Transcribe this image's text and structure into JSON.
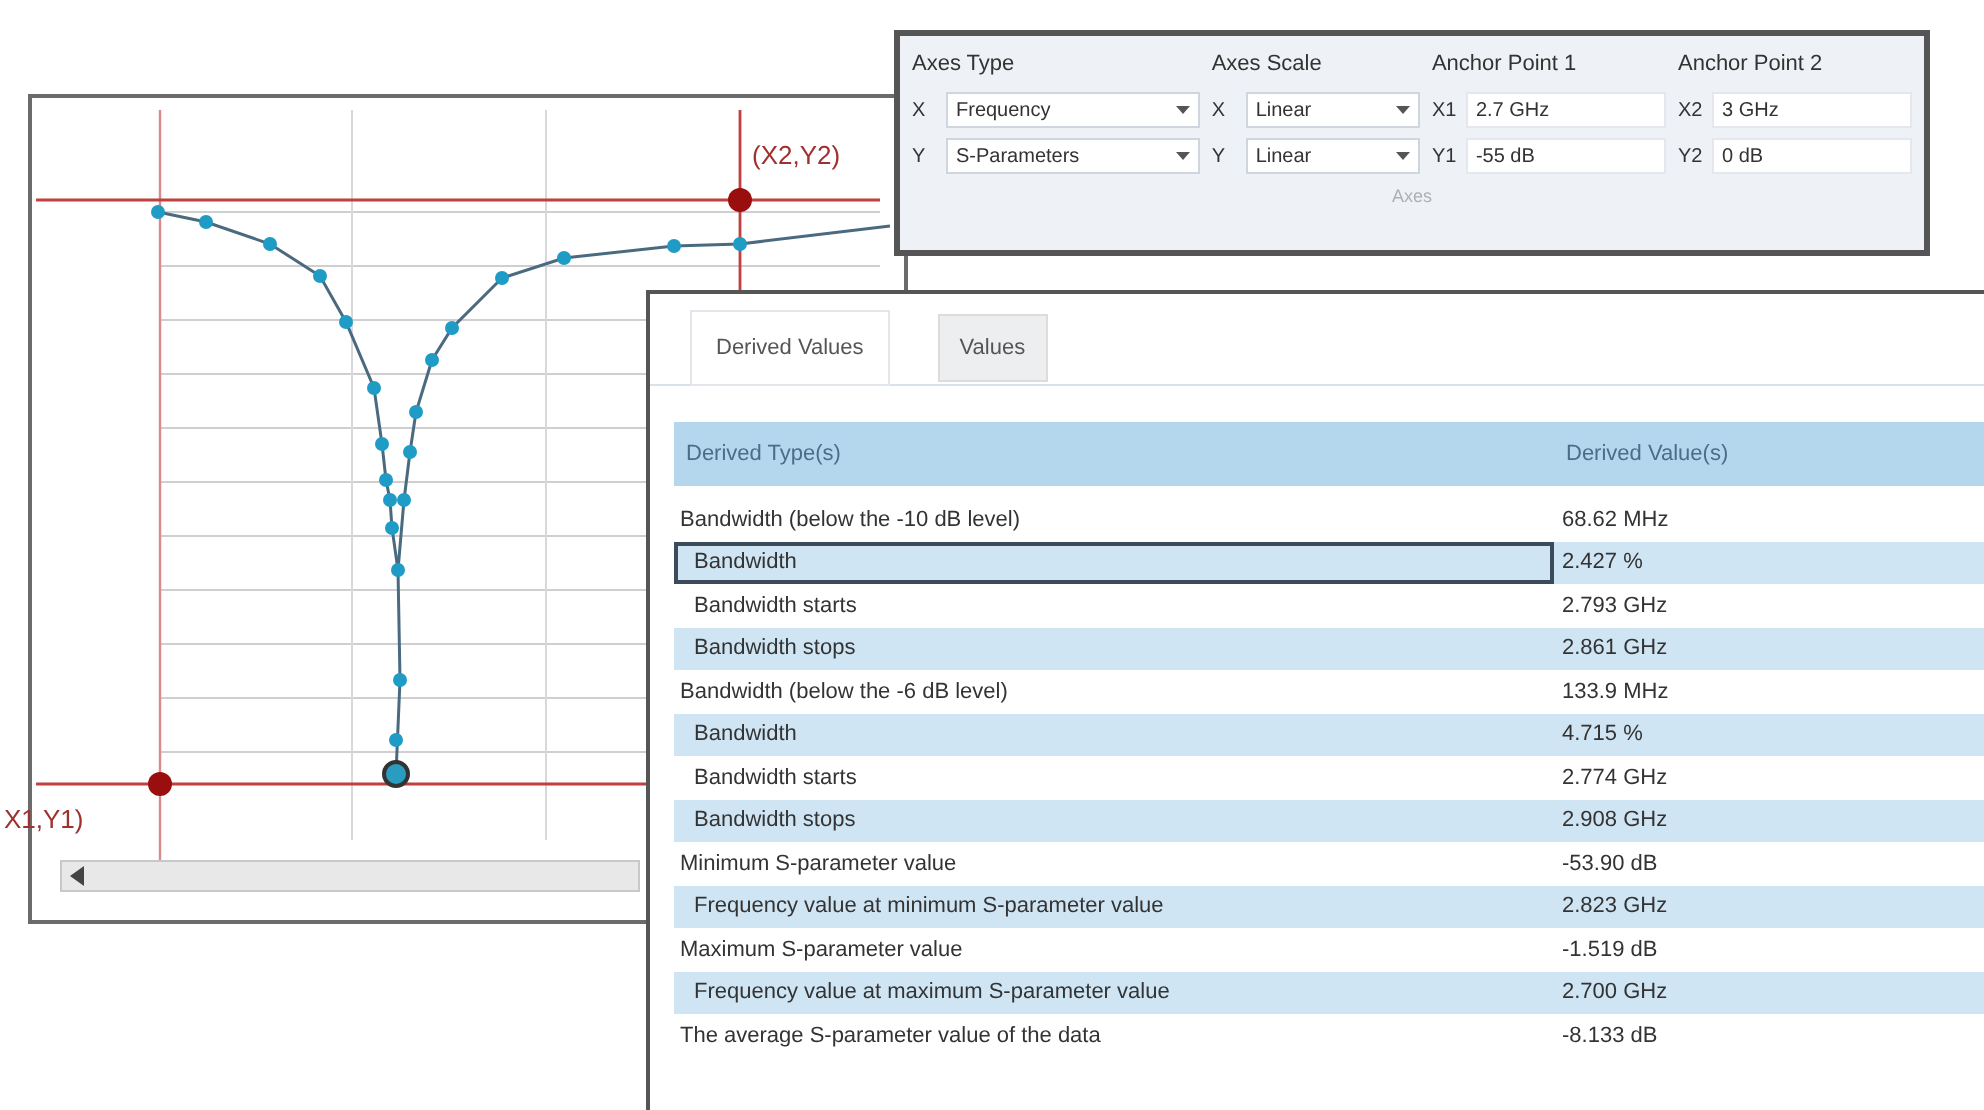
{
  "chart": {
    "anchor_labels": [
      "(X2,Y2)",
      "X1,Y1)"
    ]
  },
  "axes_panel": {
    "groups": [
      {
        "title": "Axes Type",
        "fields": [
          {
            "label": "X",
            "value": "Frequency",
            "kind": "dropdown"
          },
          {
            "label": "Y",
            "value": "S-Parameters",
            "kind": "dropdown"
          }
        ]
      },
      {
        "title": "Axes Scale",
        "fields": [
          {
            "label": "X",
            "value": "Linear",
            "kind": "dropdown"
          },
          {
            "label": "Y",
            "value": "Linear",
            "kind": "dropdown"
          }
        ]
      },
      {
        "title": "Anchor Point 1",
        "fields": [
          {
            "label": "X1",
            "value": "2.7 GHz",
            "kind": "text"
          },
          {
            "label": "Y1",
            "value": "-55 dB",
            "kind": "text"
          }
        ]
      },
      {
        "title": "Anchor Point 2",
        "fields": [
          {
            "label": "X2",
            "value": "3 GHz",
            "kind": "text"
          },
          {
            "label": "Y2",
            "value": "0 dB",
            "kind": "text"
          }
        ]
      }
    ],
    "caption": "Axes"
  },
  "results": {
    "tabs": [
      {
        "label": "Derived Values",
        "selected": true
      },
      {
        "label": "Values",
        "selected": false
      }
    ],
    "columns": [
      "Derived Type(s)",
      "Derived Value(s)"
    ],
    "rows": [
      {
        "type": "Bandwidth (below the -10 dB level)",
        "value": "68.62 MHz",
        "selected": false,
        "children": [
          {
            "type": "Bandwidth",
            "value": "2.427 %",
            "selected": true
          },
          {
            "type": "Bandwidth starts",
            "value": "2.793 GHz",
            "selected": false
          },
          {
            "type": "Bandwidth stops",
            "value": "2.861 GHz",
            "selected": false
          }
        ]
      },
      {
        "type": "Bandwidth (below the -6 dB level)",
        "value": "133.9 MHz",
        "selected": false,
        "children": [
          {
            "type": "Bandwidth",
            "value": "4.715 %",
            "selected": false
          },
          {
            "type": "Bandwidth starts",
            "value": "2.774 GHz",
            "selected": false
          },
          {
            "type": "Bandwidth stops",
            "value": "2.908 GHz",
            "selected": false
          }
        ]
      },
      {
        "type": "Minimum S-parameter value",
        "value": "-53.90 dB",
        "selected": false,
        "children": [
          {
            "type": "Frequency value at minimum S-parameter value",
            "value": "2.823 GHz",
            "selected": false
          }
        ]
      },
      {
        "type": "Maximum S-parameter value",
        "value": "-1.519 dB",
        "selected": false,
        "children": [
          {
            "type": "Frequency value at maximum S-parameter value",
            "value": "2.700 GHz",
            "selected": false
          }
        ]
      },
      {
        "type": "The average S-parameter value of the data",
        "value": "-8.133 dB",
        "selected": false
      }
    ]
  }
}
